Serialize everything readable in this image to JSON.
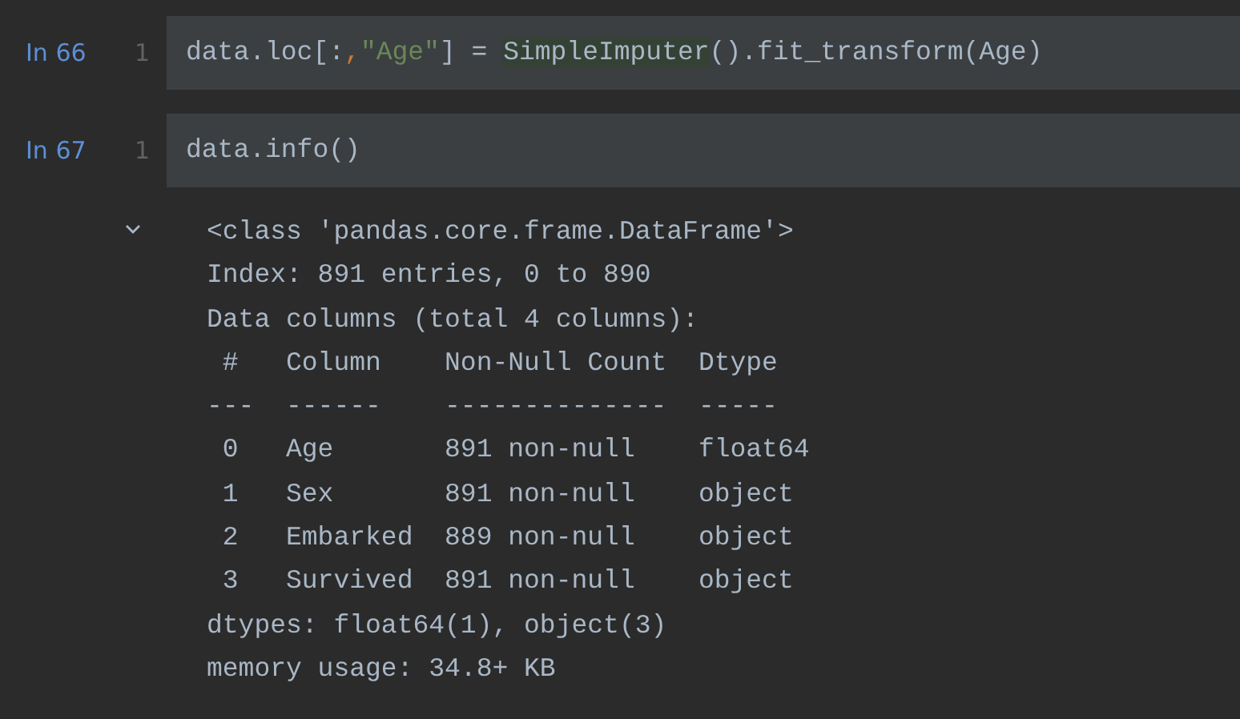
{
  "cells": [
    {
      "prompt": "In 66",
      "line_number": "1",
      "tokens": [
        {
          "kind": "plain",
          "text": "data.loc[:"
        },
        {
          "kind": "punct",
          "text": ","
        },
        {
          "kind": "string",
          "text": "\"Age\""
        },
        {
          "kind": "plain",
          "text": "] = "
        },
        {
          "kind": "highlight",
          "text": "SimpleImputer"
        },
        {
          "kind": "plain",
          "text": "().fit_transform(Age)"
        }
      ]
    },
    {
      "prompt": "In 67",
      "line_number": "1",
      "tokens": [
        {
          "kind": "plain",
          "text": "data.info()"
        }
      ],
      "output": {
        "expanded": true,
        "lines": [
          "<class 'pandas.core.frame.DataFrame'>",
          "Index: 891 entries, 0 to 890",
          "Data columns (total 4 columns):",
          " #   Column    Non-Null Count  Dtype  ",
          "---  ------    --------------  -----  ",
          " 0   Age       891 non-null    float64",
          " 1   Sex       891 non-null    object ",
          " 2   Embarked  889 non-null    object ",
          " 3   Survived  891 non-null    object ",
          "dtypes: float64(1), object(3)",
          "memory usage: 34.8+ KB"
        ]
      }
    }
  ]
}
